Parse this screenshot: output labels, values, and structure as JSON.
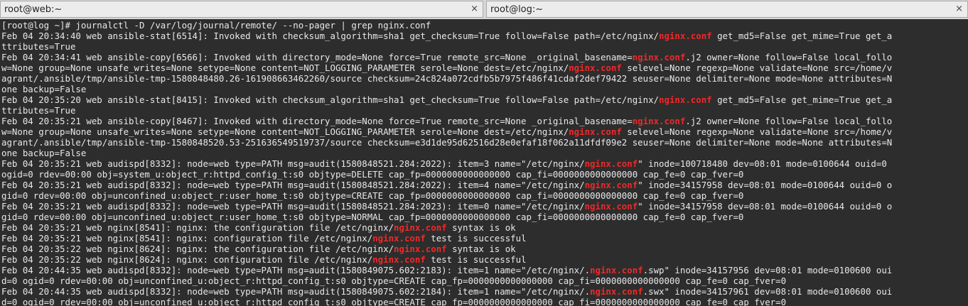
{
  "tabs": [
    {
      "title": "root@web:~",
      "close": "×"
    },
    {
      "title": "root@log:~",
      "close": "×"
    }
  ],
  "terminal": {
    "highlight": "nginx.conf",
    "lines": [
      "[root@log ~]# journalctl -D /var/log/journal/remote/ --no-pager | grep nginx.conf",
      "Feb 04 20:34:40 web ansible-stat[6514]: Invoked with checksum_algorithm=sha1 get_checksum=True follow=False path=/etc/nginx/nginx.conf get_md5=False get_mime=True get_a",
      "ttributes=True",
      "Feb 04 20:34:41 web ansible-copy[6566]: Invoked with directory_mode=None force=True remote_src=None _original_basename=nginx.conf.j2 owner=None follow=False local_follo",
      "w=None group=None unsafe_writes=None setype=None content=NOT_LOGGING_PARAMETER serole=None dest=/etc/nginx/nginx.conf selevel=None regexp=None validate=None src=/home/v",
      "agrant/.ansible/tmp/ansible-tmp-1580848480.26-161908663462260/source checksum=24c824a072cdfb5b7975f486f41cdaf2def79422 seuser=None delimiter=None mode=None attributes=N",
      "one backup=False",
      "Feb 04 20:35:20 web ansible-stat[8415]: Invoked with checksum_algorithm=sha1 get_checksum=True follow=False path=/etc/nginx/nginx.conf get_md5=False get_mime=True get_a",
      "ttributes=True",
      "Feb 04 20:35:21 web ansible-copy[8467]: Invoked with directory_mode=None force=True remote_src=None _original_basename=nginx.conf.j2 owner=None follow=False local_follo",
      "w=None group=None unsafe_writes=None setype=None content=NOT_LOGGING_PARAMETER serole=None dest=/etc/nginx/nginx.conf selevel=None regexp=None validate=None src=/home/v",
      "agrant/.ansible/tmp/ansible-tmp-1580848520.53-251636549519737/source checksum=e3d1de95d62516d28e0efaf18f062a11dfdf09e2 seuser=None delimiter=None mode=None attributes=N",
      "one backup=False",
      "Feb 04 20:35:21 web audispd[8332]: node=web type=PATH msg=audit(1580848521.284:2022): item=3 name=\"/etc/nginx/nginx.conf\" inode=100718480 dev=08:01 mode=0100644 ouid=0",
      "ogid=0 rdev=00:00 obj=system_u:object_r:httpd_config_t:s0 objtype=DELETE cap_fp=0000000000000000 cap_fi=0000000000000000 cap_fe=0 cap_fver=0",
      "Feb 04 20:35:21 web audispd[8332]: node=web type=PATH msg=audit(1580848521.284:2022): item=4 name=\"/etc/nginx/nginx.conf\" inode=34157958 dev=08:01 mode=0100644 ouid=0 o",
      "gid=0 rdev=00:00 obj=unconfined_u:object_r:user_home_t:s0 objtype=CREATE cap_fp=0000000000000000 cap_fi=0000000000000000 cap_fe=0 cap_fver=0",
      "Feb 04 20:35:21 web audispd[8332]: node=web type=PATH msg=audit(1580848521.284:2023): item=0 name=\"/etc/nginx/nginx.conf\" inode=34157958 dev=08:01 mode=0100644 ouid=0 o",
      "gid=0 rdev=00:00 obj=unconfined_u:object_r:user_home_t:s0 objtype=NORMAL cap_fp=0000000000000000 cap_fi=0000000000000000 cap_fe=0 cap_fver=0",
      "Feb 04 20:35:21 web nginx[8541]: nginx: the configuration file /etc/nginx/nginx.conf syntax is ok",
      "Feb 04 20:35:21 web nginx[8541]: nginx: configuration file /etc/nginx/nginx.conf test is successful",
      "Feb 04 20:35:22 web nginx[8624]: nginx: the configuration file /etc/nginx/nginx.conf syntax is ok",
      "Feb 04 20:35:22 web nginx[8624]: nginx: configuration file /etc/nginx/nginx.conf test is successful",
      "Feb 04 20:44:35 web audispd[8332]: node=web type=PATH msg=audit(1580849075.602:2183): item=1 name=\"/etc/nginx/.nginx.conf.swp\" inode=34157956 dev=08:01 mode=0100600 oui",
      "d=0 ogid=0 rdev=00:00 obj=unconfined_u:object_r:httpd_config_t:s0 objtype=CREATE cap_fp=0000000000000000 cap_fi=0000000000000000 cap_fe=0 cap_fver=0",
      "Feb 04 20:44:35 web audispd[8332]: node=web type=PATH msg=audit(1580849075.602:2184): item=1 name=\"/etc/nginx/.nginx.conf.swx\" inode=34157961 dev=08:01 mode=0100600 oui",
      "d=0 ogid=0 rdev=00:00 obj=unconfined_u:object_r:httpd_config_t:s0 objtype=CREATE cap_fp=0000000000000000 cap_fi=0000000000000000 cap_fe=0 cap_fver=0"
    ]
  }
}
